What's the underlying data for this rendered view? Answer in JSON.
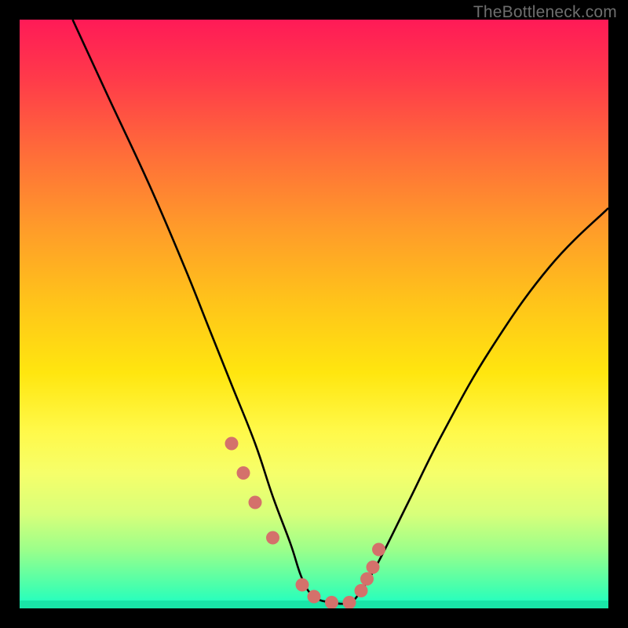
{
  "watermark": "TheBottleneck.com",
  "chart_data": {
    "type": "line",
    "title": "",
    "xlabel": "",
    "ylabel": "",
    "xlim": [
      0,
      100
    ],
    "ylim": [
      0,
      100
    ],
    "series": [
      {
        "name": "bottleneck-curve",
        "x": [
          9,
          15,
          22,
          28,
          32,
          36,
          40,
          43,
          46,
          48,
          50,
          53,
          56,
          58,
          61,
          66,
          72,
          80,
          90,
          100
        ],
        "values": [
          100,
          87,
          72,
          58,
          48,
          38,
          28,
          19,
          11,
          5,
          2,
          1,
          1,
          3,
          8,
          18,
          30,
          44,
          58,
          68
        ]
      }
    ],
    "markers": {
      "name": "highlight-dots",
      "color": "#d4716b",
      "x": [
        36,
        38,
        40,
        43,
        48,
        50,
        53,
        56,
        58,
        59,
        60,
        61
      ],
      "values": [
        28,
        23,
        18,
        12,
        4,
        2,
        1,
        1,
        3,
        5,
        7,
        10
      ]
    },
    "background_gradient": {
      "top": "#ff1a57",
      "mid": "#ffe60f",
      "bottom": "#19ffc7"
    }
  }
}
